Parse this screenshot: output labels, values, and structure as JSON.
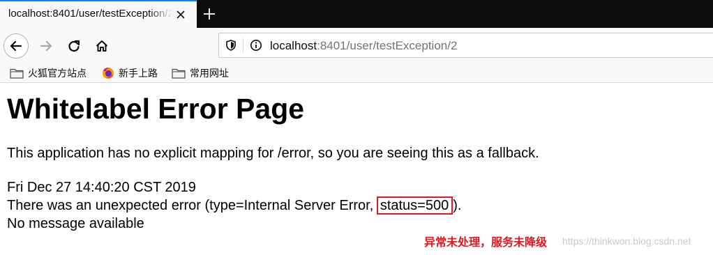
{
  "tab": {
    "title": "localhost:8401/user/testException/2"
  },
  "navbar": {
    "url_host": "localhost",
    "url_rest": ":8401/user/testException/2"
  },
  "bookmarks": [
    {
      "label": "火狐官方站点",
      "icon": "folder-icon"
    },
    {
      "label": "新手上路",
      "icon": "firefox-icon"
    },
    {
      "label": "常用网址",
      "icon": "folder-icon"
    }
  ],
  "page": {
    "title": "Whitelabel Error Page",
    "description": "This application has no explicit mapping for /error, so you are seeing this as a fallback.",
    "timestamp": "Fri Dec 27 14:40:20 CST 2019",
    "error_prefix": "There was an unexpected error (type=Internal Server Error, ",
    "error_status": "status=500",
    "error_suffix": ").",
    "message": "No message available"
  },
  "annotation": {
    "text": "异常未处理，服务未降级",
    "color": "#e1171e"
  },
  "watermark": {
    "text": "https://thinkwon.blog.csdn.net"
  },
  "colors": {
    "accent": "#0a84ff",
    "highlight": "#e1171e"
  }
}
